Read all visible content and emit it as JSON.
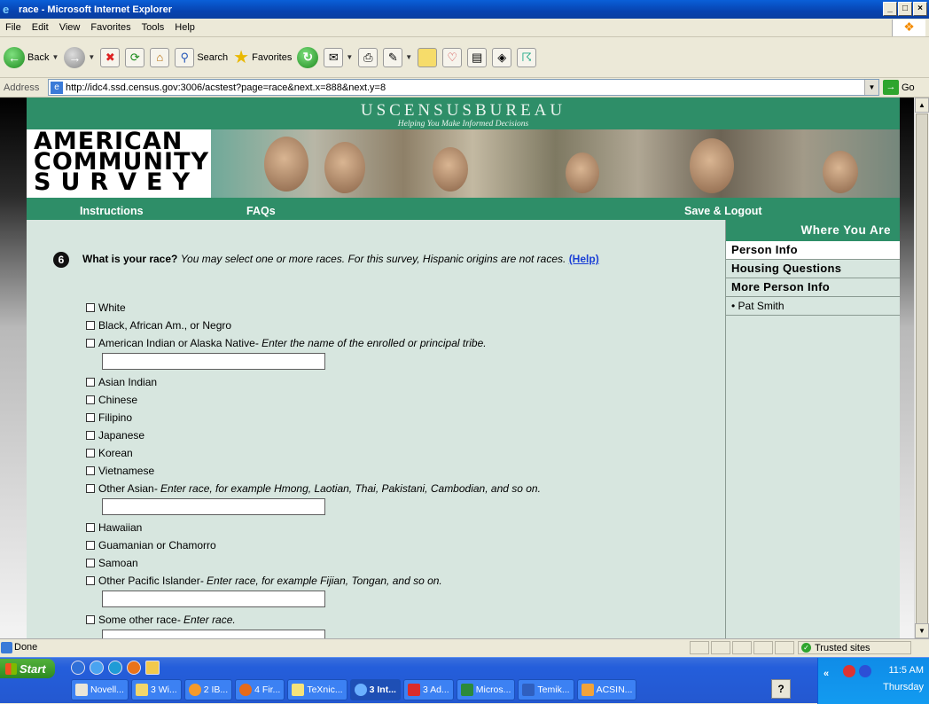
{
  "window": {
    "title": "race - Microsoft Internet Explorer",
    "buttons": [
      "_",
      "□",
      "×"
    ]
  },
  "menu": [
    "File",
    "Edit",
    "View",
    "Favorites",
    "Tools",
    "Help"
  ],
  "toolbar": {
    "back": "Back",
    "search": "Search",
    "favorites": "Favorites"
  },
  "address": {
    "label": "Address",
    "url": "http://idc4.ssd.census.gov:3006/acstest?page=race&next.x=888&next.y=8",
    "go": "Go"
  },
  "banner": {
    "agency": "USCENSUSBUREAU",
    "tagline": "Helping You Make Informed Decisions",
    "logo_lines": [
      "AMERICAN",
      "COMMUNITY",
      "SURVEY"
    ]
  },
  "nav": {
    "instructions": "Instructions",
    "faqs": "FAQs",
    "save_logout": "Save & Logout"
  },
  "sidebar": {
    "heading": "Where You Are",
    "items": [
      "Person Info",
      "Housing Questions",
      "More Person Info"
    ],
    "person": "• Pat Smith"
  },
  "question": {
    "number": "6",
    "bold": "What is your race?",
    "italic": "You may select one or more races. For this survey, Hispanic origins are not races.",
    "help": "(Help)"
  },
  "options": [
    {
      "label": "White"
    },
    {
      "label": "Black, African Am., or Negro"
    },
    {
      "label": "American Indian or Alaska Native",
      "note": " - Enter the name of the enrolled or principal tribe."
    },
    {
      "label": "Asian Indian"
    },
    {
      "label": "Chinese"
    },
    {
      "label": "Filipino"
    },
    {
      "label": "Japanese"
    },
    {
      "label": "Korean"
    },
    {
      "label": "Vietnamese"
    },
    {
      "label": "Other Asian",
      "note": " - Enter race, for example Hmong, Laotian, Thai, Pakistani, Cambodian, and so on."
    },
    {
      "label": "Hawaiian"
    },
    {
      "label": "Guamanian or Chamorro"
    },
    {
      "label": "Samoan"
    },
    {
      "label": "Other Pacific Islander",
      "note": " - Enter race, for example Fijian, Tongan, and so on."
    },
    {
      "label": "Some other race",
      "note": " - Enter race."
    }
  ],
  "status": {
    "text": "Done",
    "zone": "Trusted sites"
  },
  "taskbar": {
    "start": "Start",
    "tasks": [
      "Novell...",
      "3 Wi...",
      "2 IB...",
      "4 Fir...",
      "TeXnic...",
      "3 Int...",
      "3 Ad...",
      "Micros...",
      "Temik...",
      "ACSIN..."
    ],
    "time": "11:5 AM",
    "day": "Thursday",
    "chevron": "«"
  }
}
